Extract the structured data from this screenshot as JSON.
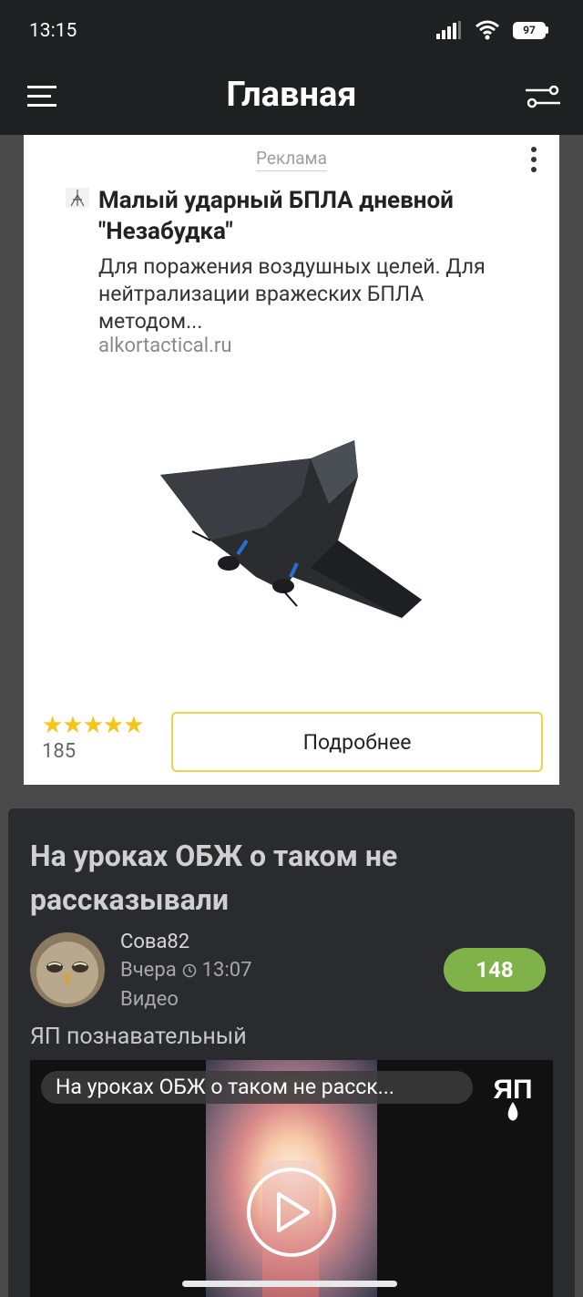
{
  "status_bar": {
    "time": "13:15",
    "battery": "97",
    "icons": [
      "signal-icon",
      "wifi-icon",
      "battery-icon"
    ]
  },
  "app_bar": {
    "title": "Главная",
    "left_icon": "menu-icon",
    "right_icon": "filter-icon"
  },
  "ad": {
    "label": "Реклама",
    "headline": "Малый ударный БПЛА дневной \"Незабудка\"",
    "description": "Для поражения воздушных целей. Для нейтрализации вражеских БПЛА методом...",
    "domain": "alkortactical.ru",
    "rating_stars": 5,
    "stars_text": "★★★★★",
    "rating_count": "185",
    "button_label": "Подробнее",
    "accent_color": "#f1d34a",
    "star_color": "#f5c518"
  },
  "post": {
    "title": "На уроках ОБЖ о таком не рассказывали",
    "author": "Сова82",
    "date": "Вчера",
    "time": "13:07",
    "type": "Видео",
    "score": "148",
    "score_color": "#7fb34a",
    "channel": "ЯП познавательный",
    "video": {
      "title": "На уроках ОБЖ о таком не расск...",
      "logo_text": "ЯП"
    }
  }
}
